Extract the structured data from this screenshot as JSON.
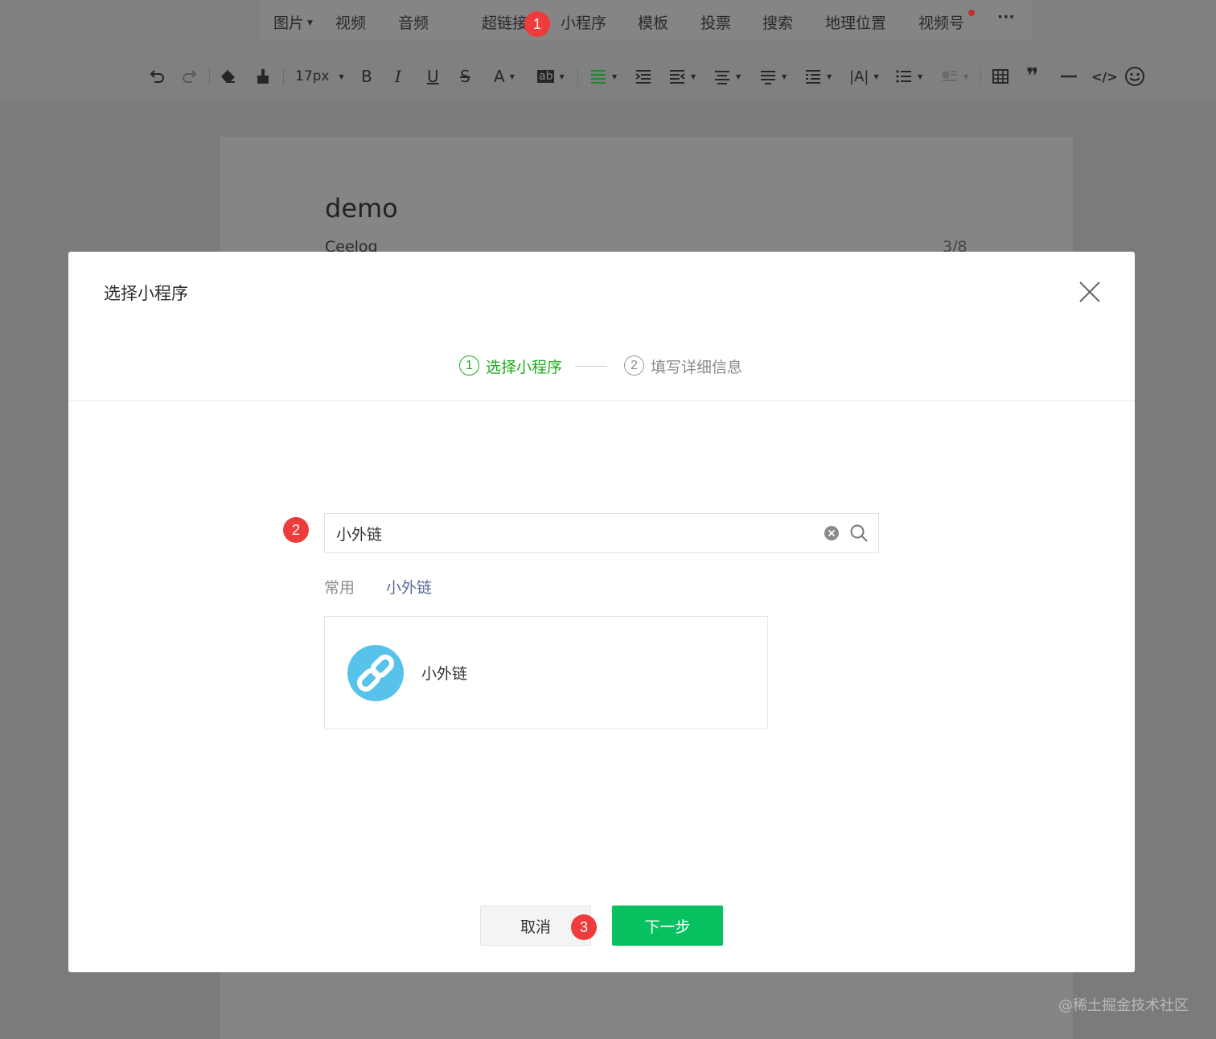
{
  "insert_menu": {
    "items": [
      {
        "label": "图片",
        "has_caret": true
      },
      {
        "label": "视频"
      },
      {
        "label": "音频"
      },
      {
        "label": "超链接"
      },
      {
        "label": "小程序"
      },
      {
        "label": "模板"
      },
      {
        "label": "投票"
      },
      {
        "label": "搜索"
      },
      {
        "label": "地理位置"
      },
      {
        "label": "视频号",
        "has_dot": true
      }
    ],
    "more": "···"
  },
  "toolbar": {
    "font_size": "17px",
    "bold": "B",
    "italic": "I",
    "underline": "U",
    "strike": "S",
    "font_color": "A",
    "bg_color": "ab"
  },
  "document": {
    "title": "demo",
    "author": "Ceelog",
    "count": "3/8"
  },
  "markers": {
    "m1": "1",
    "m2": "2",
    "m3": "3"
  },
  "modal": {
    "title": "选择小程序",
    "steps": [
      {
        "num": "1",
        "label": "选择小程序",
        "active": true
      },
      {
        "num": "2",
        "label": "填写详细信息",
        "active": false
      }
    ],
    "search": {
      "value": "小外链"
    },
    "tabs": {
      "common": "常用",
      "result": "小外链"
    },
    "result_card": {
      "name": "小外链",
      "icon": "link-icon"
    },
    "buttons": {
      "cancel": "取消",
      "next": "下一步"
    }
  },
  "watermark": "@稀土掘金技术社区",
  "colors": {
    "accent_green": "#07c160",
    "step_green": "#1aad19",
    "marker_red": "#ee3c3c",
    "link_blue": "#576b95",
    "logo_blue": "#58c3ea"
  }
}
